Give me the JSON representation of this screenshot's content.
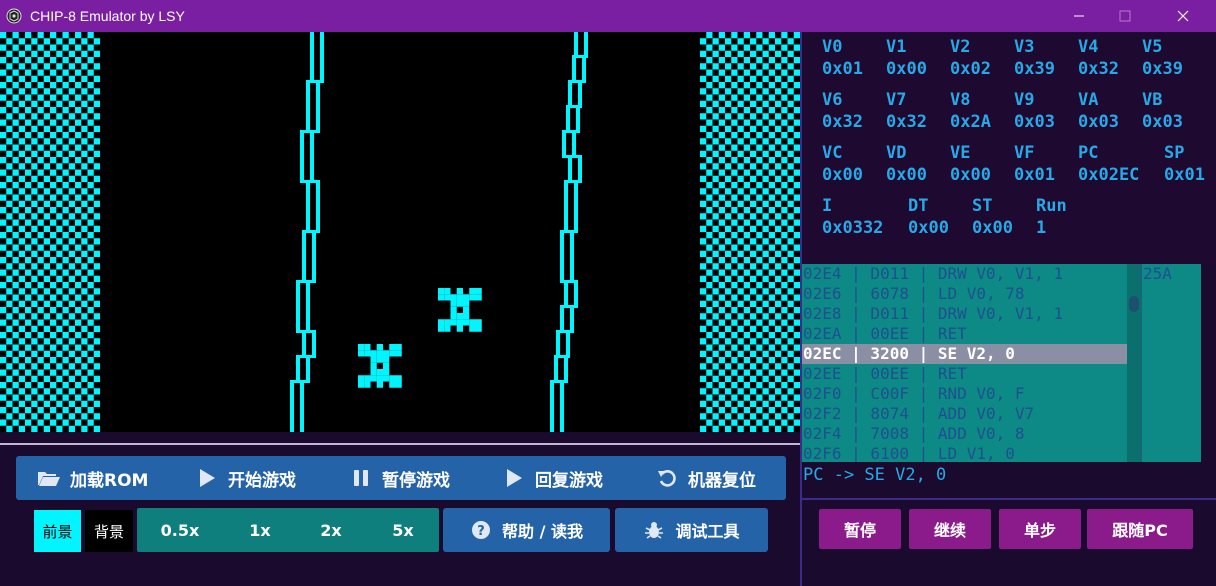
{
  "window": {
    "title": "CHIP-8 Emulator by LSY"
  },
  "colors": {
    "foreground": "#00f5ff",
    "background": "#000000",
    "accent": "#7b1fa2",
    "button_blue": "#2563a8",
    "button_teal": "#0e7f7c",
    "button_purple": "#8b1a8a"
  },
  "controls": {
    "load_rom": {
      "label": "加载ROM",
      "icon": "folder-open-icon"
    },
    "start": {
      "label": "开始游戏",
      "icon": "play-icon"
    },
    "pause": {
      "label": "暂停游戏",
      "icon": "pause-icon"
    },
    "resume": {
      "label": "回复游戏",
      "icon": "play-icon"
    },
    "reset": {
      "label": "机器复位",
      "icon": "undo-icon"
    }
  },
  "color_buttons": {
    "foreground": "前景",
    "background": "背景"
  },
  "speeds": [
    "0.5x",
    "1x",
    "2x",
    "5x"
  ],
  "help_button": {
    "label": "帮助 / 读我",
    "icon": "question-circle-icon"
  },
  "debug_button": {
    "label": "调试工具",
    "icon": "bug-icon"
  },
  "registers": [
    {
      "name": "V0",
      "value": "0x01"
    },
    {
      "name": "V1",
      "value": "0x00"
    },
    {
      "name": "V2",
      "value": "0x02"
    },
    {
      "name": "V3",
      "value": "0x39"
    },
    {
      "name": "V4",
      "value": "0x32"
    },
    {
      "name": "V5",
      "value": "0x39"
    },
    {
      "name": "V6",
      "value": "0x32"
    },
    {
      "name": "V7",
      "value": "0x32"
    },
    {
      "name": "V8",
      "value": "0x2A"
    },
    {
      "name": "V9",
      "value": "0x03"
    },
    {
      "name": "VA",
      "value": "0x03"
    },
    {
      "name": "VB",
      "value": "0x03"
    },
    {
      "name": "VC",
      "value": "0x00"
    },
    {
      "name": "VD",
      "value": "0x00"
    },
    {
      "name": "VE",
      "value": "0x00"
    },
    {
      "name": "VF",
      "value": "0x01"
    },
    {
      "name": "PC",
      "value": "0x02EC"
    },
    {
      "name": "SP",
      "value": "0x01"
    },
    {
      "name": "I",
      "value": "0x0332"
    },
    {
      "name": "DT",
      "value": "0x00"
    },
    {
      "name": "ST",
      "value": "0x00"
    },
    {
      "name": "Run",
      "value": "1"
    }
  ],
  "disassembly": [
    {
      "addr": "02E4",
      "op": "D011",
      "asm": "DRW V0, V1, 1"
    },
    {
      "addr": "02E6",
      "op": "6078",
      "asm": "LD V0, 78"
    },
    {
      "addr": "02E8",
      "op": "D011",
      "asm": "DRW V0, V1, 1"
    },
    {
      "addr": "02EA",
      "op": "00EE",
      "asm": "RET"
    },
    {
      "addr": "02EC",
      "op": "3200",
      "asm": "SE V2, 0",
      "current": true
    },
    {
      "addr": "02EE",
      "op": "00EE",
      "asm": "RET"
    },
    {
      "addr": "02F0",
      "op": "C00F",
      "asm": "RND V0, F"
    },
    {
      "addr": "02F2",
      "op": "8074",
      "asm": "ADD V0, V7"
    },
    {
      "addr": "02F4",
      "op": "7008",
      "asm": "ADD V0, 8"
    },
    {
      "addr": "02F6",
      "op": "6100",
      "asm": "LD V1, 0"
    }
  ],
  "side_column": [
    "25A"
  ],
  "pc_status": "PC -> SE V2, 0",
  "debug_controls": {
    "pause": "暂停",
    "continue": "继续",
    "step": "单步",
    "follow_pc": "跟随PC"
  }
}
